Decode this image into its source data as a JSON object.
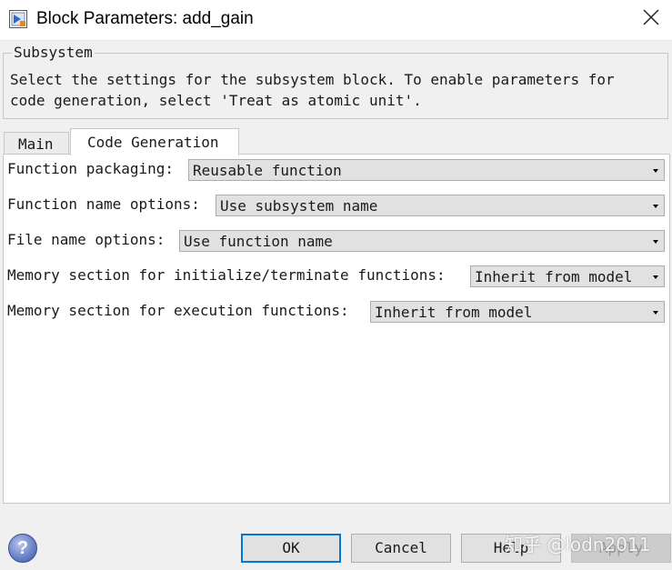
{
  "window": {
    "title": "Block Parameters: add_gain",
    "icon": "simulink-block-icon",
    "close_icon": "close-icon"
  },
  "group": {
    "legend": "Subsystem",
    "description": "Select the settings for the subsystem block. To enable parameters for\ncode generation, select 'Treat as atomic unit'."
  },
  "tabs": [
    {
      "label": "Main",
      "active": false
    },
    {
      "label": "Code Generation",
      "active": true
    }
  ],
  "params": [
    {
      "label": "Function packaging:",
      "value": "Reusable function"
    },
    {
      "label": "Function name options:",
      "value": "Use subsystem name"
    },
    {
      "label": "File name options:",
      "value": "Use function name"
    },
    {
      "label": "Memory section for initialize/terminate functions:",
      "value": "Inherit from model"
    },
    {
      "label": "Memory section for execution functions:",
      "value": "Inherit from model"
    }
  ],
  "buttons": {
    "help_icon": "question-icon",
    "ok": "OK",
    "cancel": "Cancel",
    "help": "Help",
    "apply": "Apply"
  },
  "watermark": "知乎 @lodn2011",
  "colors": {
    "accent": "#0078d7",
    "background": "#f0f0f0",
    "panel": "#ffffff",
    "dropdown": "#e1e1e1"
  }
}
